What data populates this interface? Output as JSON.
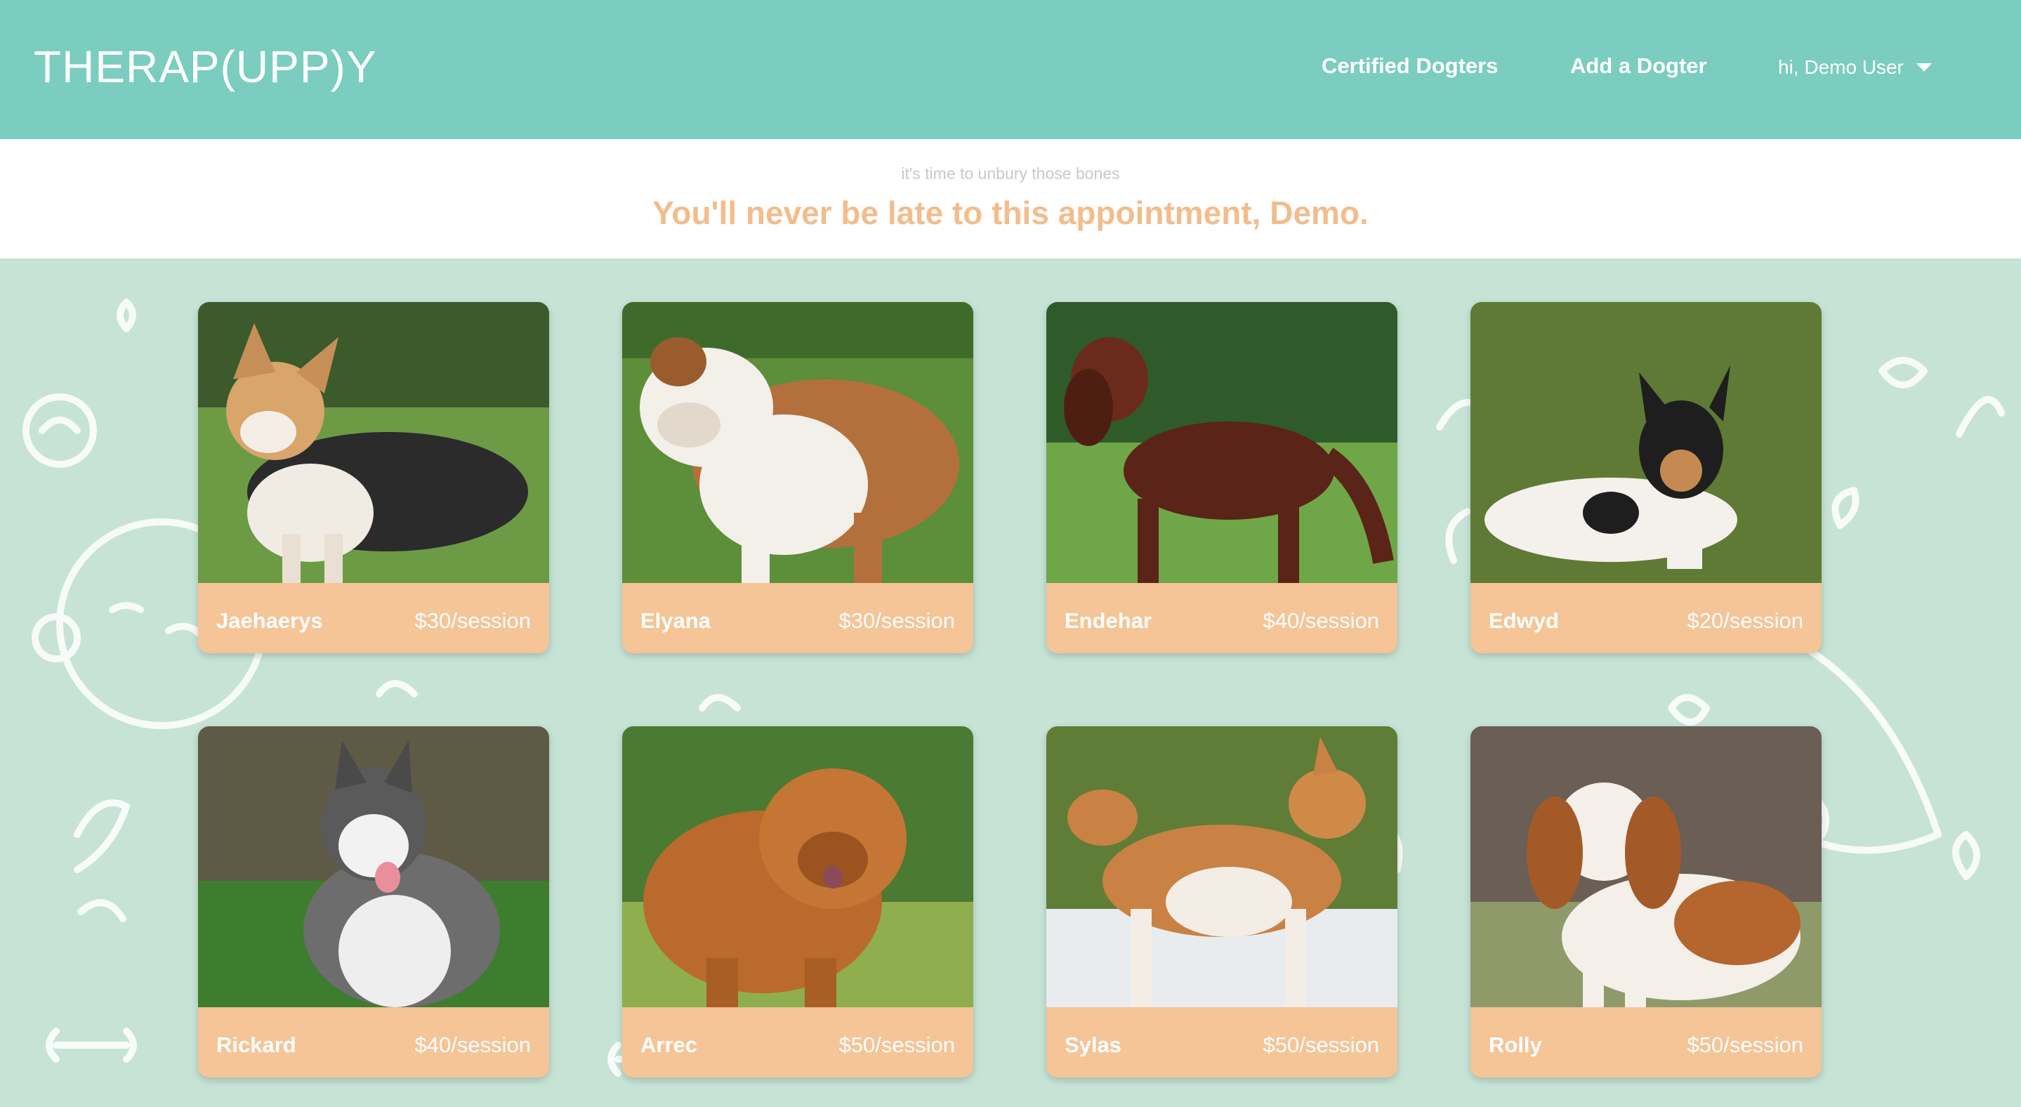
{
  "nav": {
    "brand": "THERAP(UPP)Y",
    "links": [
      "Certified Dogters",
      "Add a Dogter"
    ],
    "user_greeting": "hi, Demo User"
  },
  "hero": {
    "tagline": "it's time to unbury those bones",
    "greeting": "You'll never be late to this appointment, Demo."
  },
  "dogs": [
    {
      "name": "Jaehaerys",
      "price": "$30/session",
      "icon": "corgi-photo"
    },
    {
      "name": "Elyana",
      "price": "$30/session",
      "icon": "bulldog-photo"
    },
    {
      "name": "Endehar",
      "price": "$40/session",
      "icon": "irish-setter-photo"
    },
    {
      "name": "Edwyd",
      "price": "$20/session",
      "icon": "rat-terrier-photo"
    },
    {
      "name": "Rickard",
      "price": "$40/session",
      "icon": "husky-photo"
    },
    {
      "name": "Arrec",
      "price": "$50/session",
      "icon": "chow-chow-photo"
    },
    {
      "name": "Sylas",
      "price": "$50/session",
      "icon": "akita-photo"
    },
    {
      "name": "Rolly",
      "price": "$50/session",
      "icon": "cavalier-photo"
    }
  ],
  "colors": {
    "navbar": "#7acdbf",
    "background": "#c6e3d6",
    "accent": "#f5c497",
    "greeting": "#f2bd8c"
  }
}
